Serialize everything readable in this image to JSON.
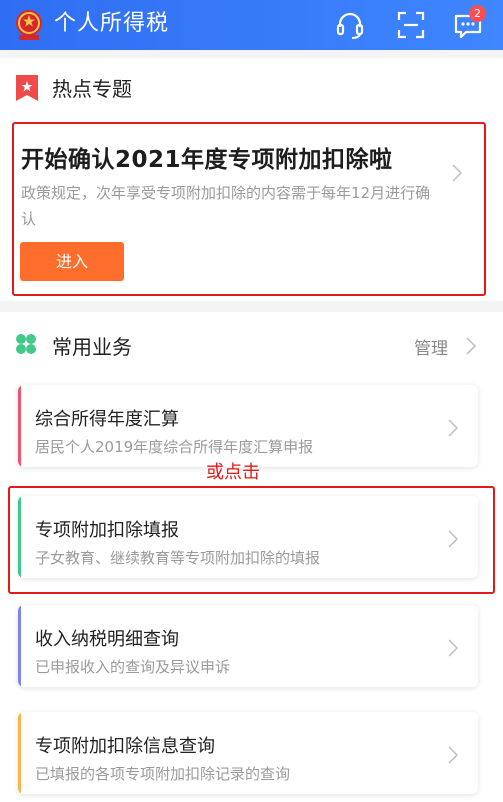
{
  "header": {
    "app_title": "个人所得税",
    "emblem_icon": "national-emblem-icon",
    "service_icon": "customer-service-headset-icon",
    "scan_icon": "scan-icon",
    "message_icon": "message-icon",
    "message_badge": "2",
    "accent_color": "#3478f6"
  },
  "hot_topics": {
    "title": "热点专题",
    "icon": "bookmark-star-icon",
    "promo": {
      "title": "开始确认2021年度专项附加扣除啦",
      "description": "政策规定，次年享受专项附加扣除的内容需于每年12月进行确认",
      "button_label": "进入",
      "button_color": "#ff6d2d"
    }
  },
  "common_services": {
    "title": "常用业务",
    "icon": "clover-icon",
    "manage_label": "管理",
    "items": [
      {
        "title": "综合所得年度汇算",
        "subtitle": "居民个人2019年度综合所得年度汇算申报",
        "accent": "#f0546e"
      },
      {
        "title": "专项附加扣除填报",
        "subtitle": "子女教育、继续教育等专项附加扣除的填报",
        "accent": "#3cc88c"
      },
      {
        "title": "收入纳税明细查询",
        "subtitle": "已申报收入的查询及异议申诉",
        "accent": "#7f83f0"
      },
      {
        "title": "专项附加扣除信息查询",
        "subtitle": "已填报的各项专项附加扣除记录的查询",
        "accent": "#f7b64c"
      }
    ]
  },
  "annotation": {
    "text": "或点击",
    "color": "#e31a1a"
  }
}
